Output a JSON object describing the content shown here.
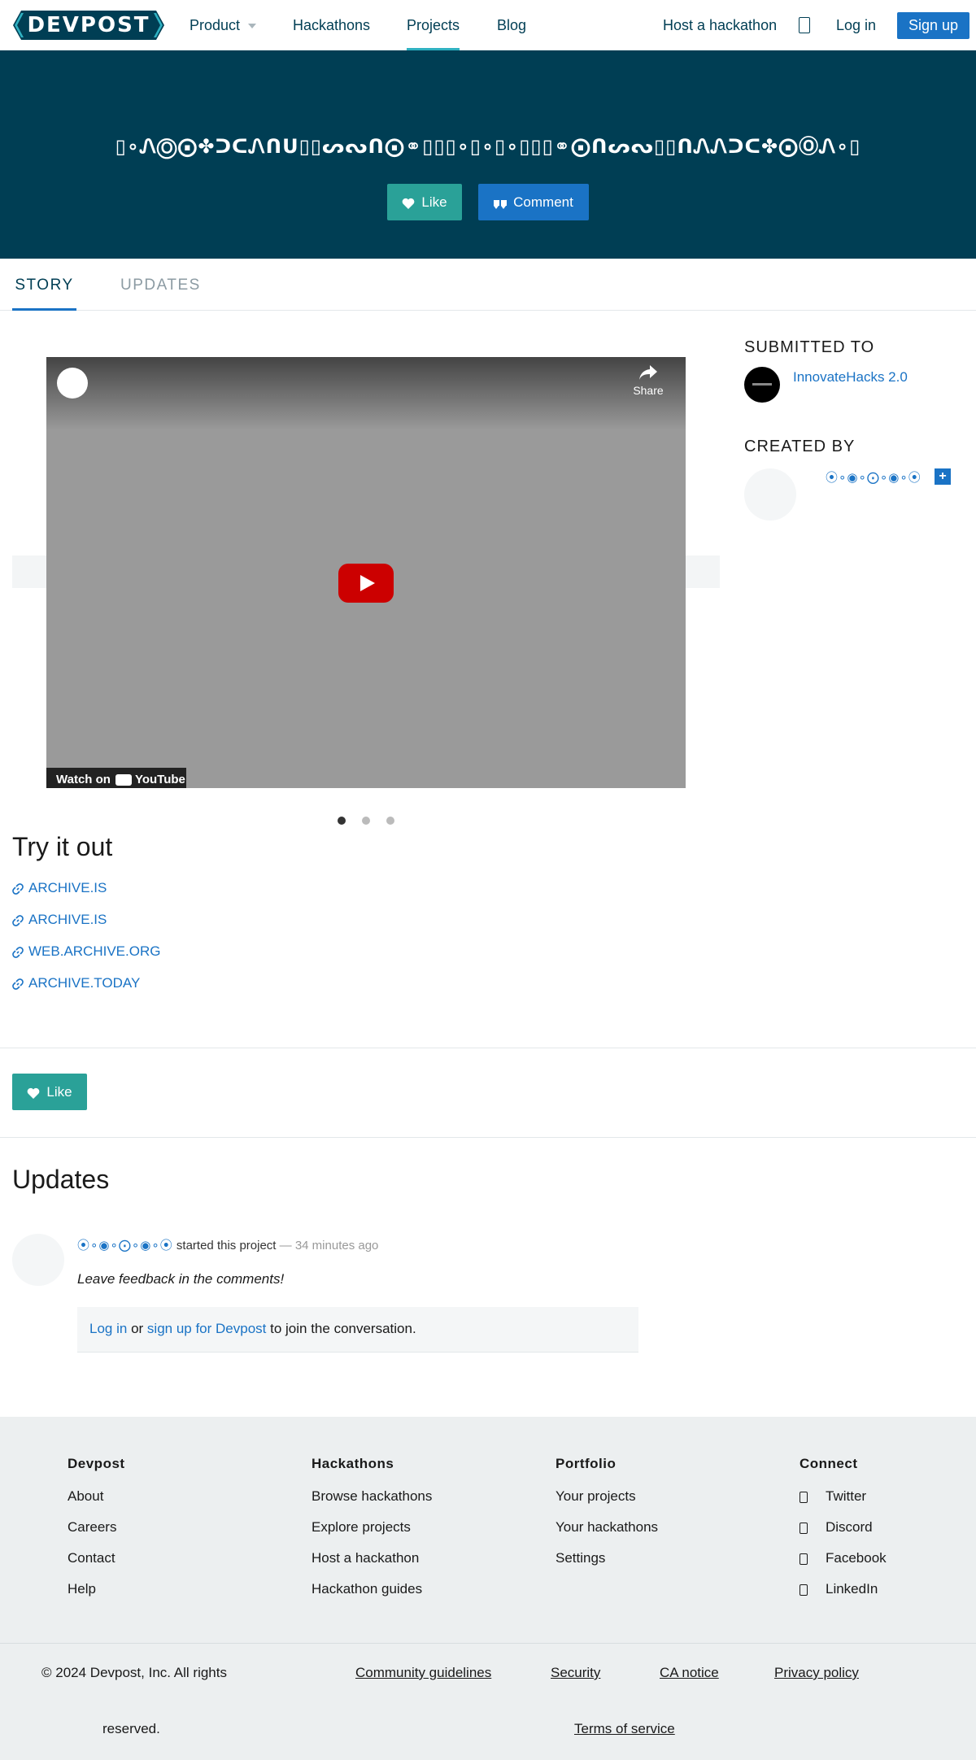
{
  "header": {
    "logo": "DEVPOST",
    "nav": [
      {
        "label": "Product"
      },
      {
        "label": "Hackathons"
      },
      {
        "label": "Projects"
      },
      {
        "label": "Blog"
      }
    ],
    "host_link": "Host a hackathon",
    "search_icon": "search-icon",
    "login": "Log in",
    "signup": "Sign up"
  },
  "hero": {
    "title": "▯∘ᏁⓄ⨀✤ᑐᑕᏁᑎᑌ▯▯ᔕᔓᑎ⨀⚭▯▯▯∘▯∘▯∘▯▯▯⚭⨀ᑎᔕᔓ▯▯ᑎᏁᏁᑐᑕ✤⨀ⓄᏁ∘▯",
    "like": "Like",
    "comment": "Comment"
  },
  "tabs": {
    "story": "STORY",
    "updates": "UPDATES"
  },
  "video": {
    "share": "Share",
    "watch_on": "Watch on",
    "youtube": "YouTube",
    "play_icon": "youtube-play-icon"
  },
  "sidebar": {
    "submitted_to": "SUBMITTED TO",
    "challenge": "InnovateHacks 2.0",
    "created_by": "CREATED BY",
    "creator_name": "⦿∘◉∘⨀∘◉∘⦿",
    "plus": "+"
  },
  "try_it_out": {
    "title": "Try it out",
    "links": [
      {
        "label": "ARCHIVE.IS"
      },
      {
        "label": "ARCHIVE.IS"
      },
      {
        "label": "WEB.ARCHIVE.ORG"
      },
      {
        "label": "ARCHIVE.TODAY"
      }
    ]
  },
  "like_bottom": "Like",
  "updates": {
    "title": "Updates",
    "author": "⦿∘◉∘⨀∘◉∘⦿",
    "action": "started this project",
    "time": "— 34 minutes ago",
    "message": "Leave feedback in the comments!",
    "join_login": "Log in",
    "join_or": "or",
    "join_signup": "sign up for Devpost",
    "join_rest": "to join the conversation."
  },
  "footer": {
    "columns": [
      {
        "title": "Devpost",
        "links": [
          "About",
          "Careers",
          "Contact",
          "Help"
        ]
      },
      {
        "title": "Hackathons",
        "links": [
          "Browse hackathons",
          "Explore projects",
          "Host a hackathon",
          "Hackathon guides"
        ]
      },
      {
        "title": "Portfolio",
        "links": [
          "Your projects",
          "Your hackathons",
          "Settings"
        ]
      },
      {
        "title": "Connect",
        "links": [
          "Twitter",
          "Discord",
          "Facebook",
          "LinkedIn"
        ]
      }
    ],
    "copyright_1": "© 2024 Devpost, Inc. All rights",
    "copyright_2": "reserved.",
    "legal": [
      "Community guidelines",
      "Security",
      "CA notice",
      "Privacy policy",
      "Terms of service"
    ]
  },
  "colors": {
    "brand_dark": "#003e54",
    "accent_blue": "#1a73c5",
    "like_teal": "#2aa198",
    "tab_underline": "#2fb0c1"
  }
}
